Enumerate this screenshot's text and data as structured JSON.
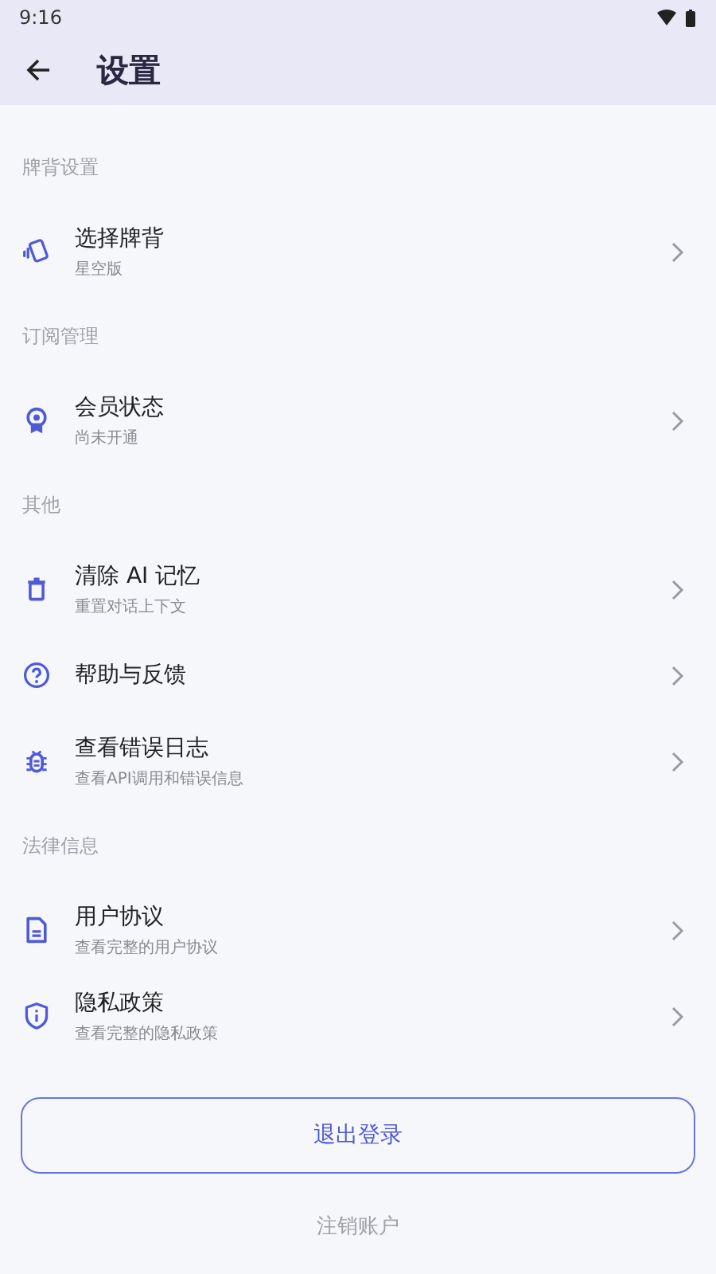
{
  "status_bar": {
    "time": "9:16"
  },
  "header": {
    "title": "设置"
  },
  "sections": [
    {
      "label": "牌背设置",
      "items": [
        {
          "kind": "cards",
          "title": "选择牌背",
          "subtitle": "星空版"
        }
      ]
    },
    {
      "label": "订阅管理",
      "items": [
        {
          "kind": "badge",
          "title": "会员状态",
          "subtitle": "尚未开通"
        }
      ]
    },
    {
      "label": "其他",
      "items": [
        {
          "kind": "trash",
          "title": "清除 AI 记忆",
          "subtitle": "重置对话上下文"
        },
        {
          "kind": "help",
          "title": "帮助与反馈"
        },
        {
          "kind": "bug",
          "title": "查看错误日志",
          "subtitle": "查看API调用和错误信息"
        }
      ]
    },
    {
      "label": "法律信息",
      "items": [
        {
          "kind": "document",
          "title": "用户协议",
          "subtitle": "查看完整的用户协议"
        },
        {
          "kind": "shield",
          "title": "隐私政策",
          "subtitle": "查看完整的隐私政策"
        }
      ]
    }
  ],
  "logout_button": "退出登录",
  "delete_account_link": "注销账户"
}
